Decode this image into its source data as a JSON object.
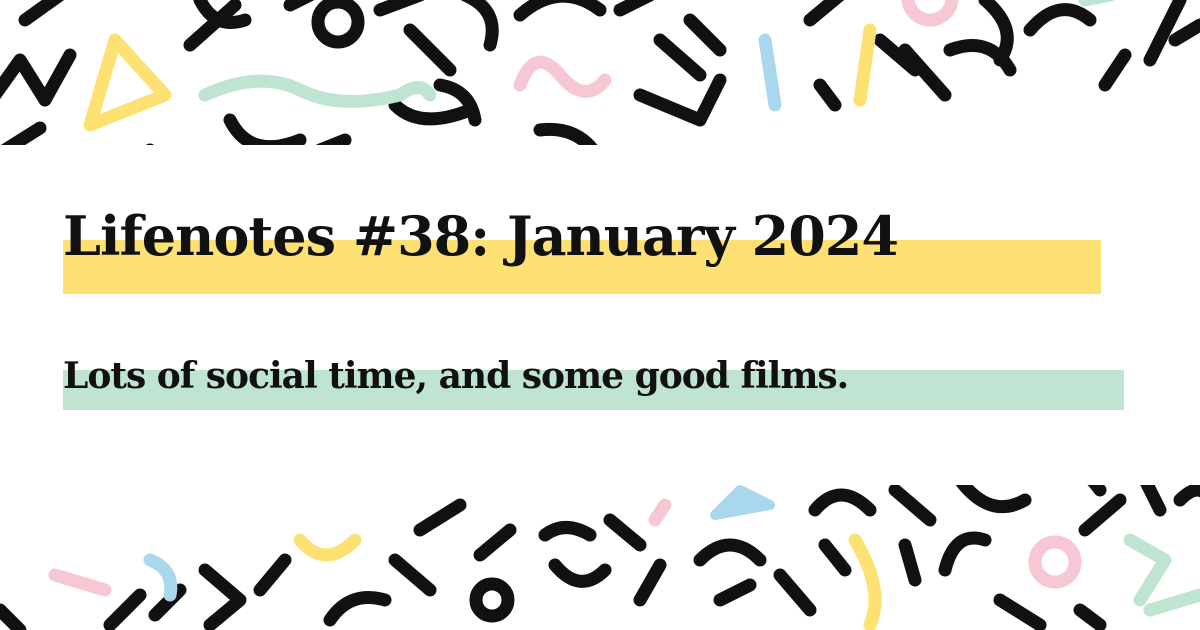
{
  "post": {
    "title": "Lifenotes #38: January 2024",
    "subtitle": "Lots of social time, and some good films."
  },
  "colors": {
    "background": "#ffffff",
    "text": "#111111",
    "title_highlight": "#fde173",
    "subtitle_highlight": "#bfe5d2",
    "pattern_black": "#111111",
    "pattern_yellow": "#fde173",
    "pattern_pink": "#f6c8d4",
    "pattern_mint": "#bfe5d2",
    "pattern_blue": "#a9d8ee"
  }
}
